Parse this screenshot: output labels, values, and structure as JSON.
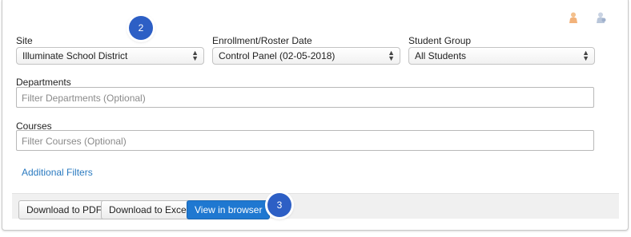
{
  "filters": {
    "site": {
      "label": "Site",
      "value": "Illuminate School District"
    },
    "enrollment": {
      "label": "Enrollment/Roster Date",
      "value": "Control Panel (02-05-2018)"
    },
    "student_group": {
      "label": "Student Group",
      "value": "All Students"
    },
    "departments": {
      "label": "Departments",
      "placeholder": "Filter Departments (Optional)"
    },
    "courses": {
      "label": "Courses",
      "placeholder": "Filter Courses (Optional)"
    },
    "additional_link": "Additional Filters"
  },
  "actions": {
    "pdf": "Download to PDF",
    "excel": "Download to Excel",
    "browser": "View in browser"
  },
  "badges": {
    "step2": "2",
    "step3": "3"
  },
  "colors": {
    "primary": "#1f78d1",
    "link": "#2a7ac0",
    "badge": "#2d5fc5"
  },
  "icons": [
    "user-icon",
    "favorite-user-icon"
  ]
}
